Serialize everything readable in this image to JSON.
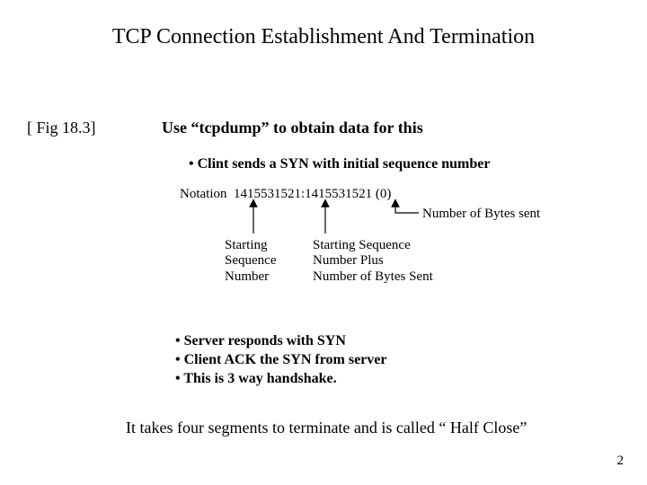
{
  "title": "TCP Connection Establishment And Termination",
  "fig_ref": "[ Fig 18.3]",
  "subhead": "Use “tcpdump” to obtain data for this",
  "bullet1": "•  Clint sends a SYN with initial sequence number",
  "notation_label": "Notation",
  "notation_value": "1415531521:1415531521 (0)",
  "bytes_sent_label": "Number of Bytes sent",
  "start_seq_l1": "Starting",
  "start_seq_l2": "Sequence",
  "start_seq_l3": "Number",
  "plus_l1": "Starting Sequence",
  "plus_l2": "Number Plus",
  "plus_l3": "Number of Bytes Sent",
  "bullets2": {
    "a": "•  Server responds with SYN",
    "b": "•  Client ACK the SYN from server",
    "c": "•  This is 3 way handshake."
  },
  "closing": "It takes four segments to terminate and is called “ Half Close”",
  "page_number": "2"
}
